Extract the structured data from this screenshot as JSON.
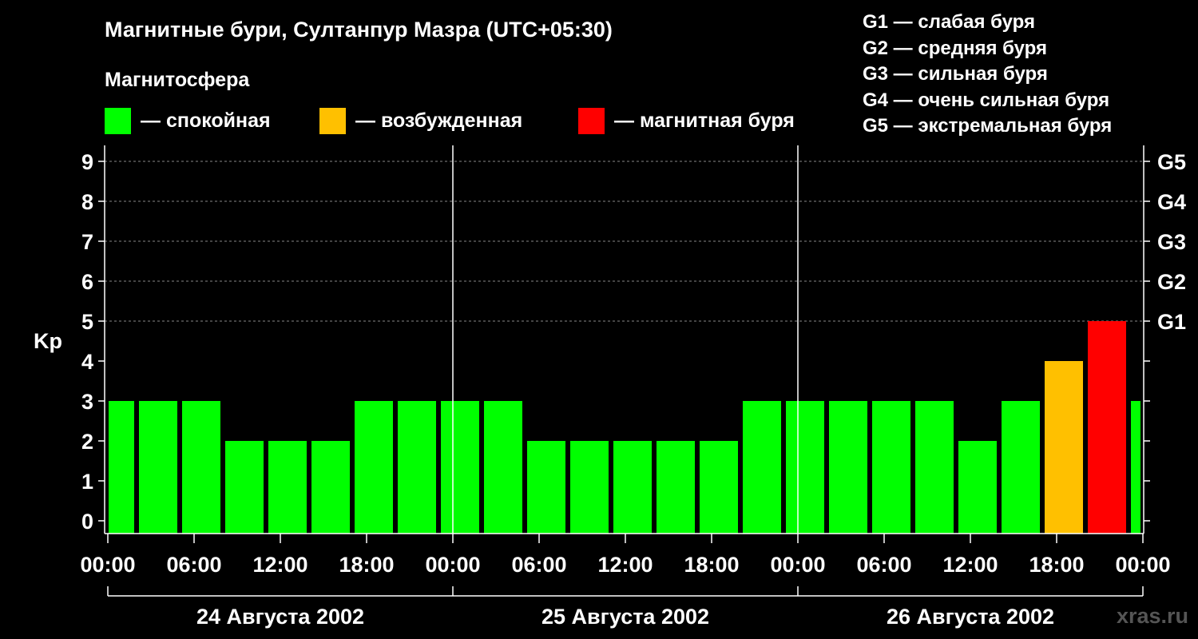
{
  "chart_data": {
    "type": "bar",
    "title": "Магнитные бури, Султанпур Мазра (UTC+05:30)",
    "subtitle": "Магнитосфера",
    "ylabel": "Kp",
    "ylim": [
      0,
      9
    ],
    "y_ticks": [
      "0",
      "1",
      "2",
      "3",
      "4",
      "5",
      "6",
      "7",
      "8",
      "9"
    ],
    "g_levels": [
      {
        "kp": 5,
        "label": "G1"
      },
      {
        "kp": 6,
        "label": "G2"
      },
      {
        "kp": 7,
        "label": "G3"
      },
      {
        "kp": 8,
        "label": "G4"
      },
      {
        "kp": 9,
        "label": "G5"
      }
    ],
    "x_tick_labels": [
      "00:00",
      "06:00",
      "12:00",
      "18:00",
      "00:00",
      "06:00",
      "12:00",
      "18:00",
      "00:00",
      "06:00",
      "12:00",
      "18:00",
      "00:00"
    ],
    "dates": [
      "24 Августа 2002",
      "25 Августа 2002",
      "26 Августа 2002"
    ],
    "values": [
      3,
      3,
      3,
      2,
      2,
      2,
      3,
      3,
      3,
      3,
      2,
      2,
      2,
      2,
      2,
      3,
      3,
      3,
      3,
      3,
      2,
      3,
      4,
      5,
      3
    ],
    "status_colors": {
      "calm": "#00ff00",
      "excited": "#ffc000",
      "storm": "#ff0000"
    },
    "grid": "dashed horizontal at Kp 5–9",
    "legend": {
      "calm": "— спокойная",
      "excited": "— возбужденная",
      "storm": "— магнитная буря"
    },
    "g_legend": [
      "G1 — слабая буря",
      "G2 — средняя буря",
      "G3 — сильная буря",
      "G4 — очень сильная буря",
      "G5 — экстремальная буря"
    ]
  },
  "watermark": "xras.ru"
}
